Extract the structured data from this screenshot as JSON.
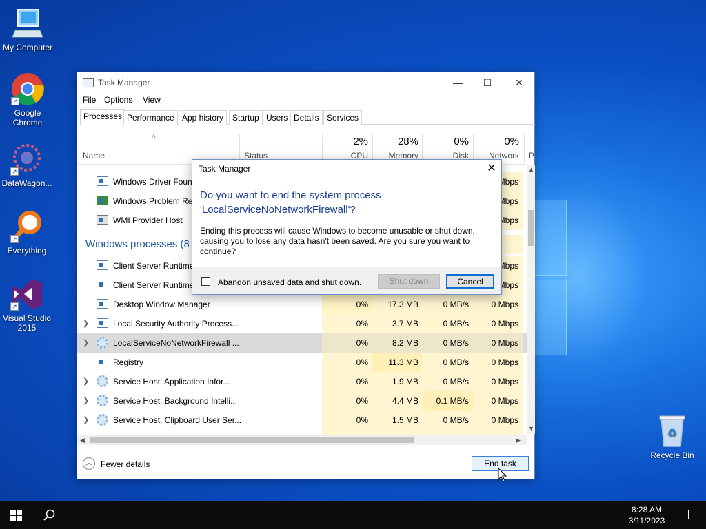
{
  "desktop": {
    "icons": [
      {
        "label": "My Computer"
      },
      {
        "label": "Google Chrome"
      },
      {
        "label": "DataWagon..."
      },
      {
        "label": "Everything"
      },
      {
        "label": "Visual Studio 2015"
      },
      {
        "label": "Recycle Bin"
      }
    ]
  },
  "window": {
    "title": "Task Manager",
    "menu": [
      "File",
      "Options",
      "View"
    ],
    "tabs": [
      "Processes",
      "Performance",
      "App history",
      "Startup",
      "Users",
      "Details",
      "Services"
    ],
    "active_tab": "Processes",
    "columns": {
      "name": "Name",
      "status": "Status",
      "cpu": {
        "pct": "2%",
        "label": "CPU"
      },
      "memory": {
        "pct": "28%",
        "label": "Memory"
      },
      "disk": {
        "pct": "0%",
        "label": "Disk"
      },
      "network": {
        "pct": "0%",
        "label": "Network"
      },
      "next": "P"
    },
    "group_label": "Windows processes (8",
    "rows_top": [
      {
        "name": "Windows Driver Found",
        "network": "Mbps"
      },
      {
        "name": "Windows Problem Rep",
        "network": "Mbps"
      },
      {
        "name": "WMI Provider Host",
        "network": "Mbps"
      }
    ],
    "rows_group": [
      {
        "name": "Client Server Runtime",
        "network": "Mbps",
        "expandable": false
      },
      {
        "name": "Client Server Runtime",
        "network": "Mbps",
        "expandable": false
      },
      {
        "name": "Desktop Window Manager",
        "cpu": "0%",
        "memory": "17.3 MB",
        "disk": "0 MB/s",
        "network": "0 Mbps",
        "expandable": false
      },
      {
        "name": "Local Security Authority Process...",
        "cpu": "0%",
        "memory": "3.7 MB",
        "disk": "0 MB/s",
        "network": "0 Mbps",
        "expandable": true
      },
      {
        "name": "LocalServiceNoNetworkFirewall ...",
        "cpu": "0%",
        "memory": "8.2 MB",
        "disk": "0 MB/s",
        "network": "0 Mbps",
        "expandable": true,
        "selected": true
      },
      {
        "name": "Registry",
        "cpu": "0%",
        "memory": "11.3 MB",
        "disk": "0 MB/s",
        "network": "0 Mbps",
        "expandable": false
      },
      {
        "name": "Service Host: Application Infor...",
        "cpu": "0%",
        "memory": "1.9 MB",
        "disk": "0 MB/s",
        "network": "0 Mbps",
        "expandable": true
      },
      {
        "name": "Service Host: Background Intelli...",
        "cpu": "0%",
        "memory": "4.4 MB",
        "disk": "0.1 MB/s",
        "network": "0 Mbps",
        "expandable": true
      },
      {
        "name": "Service Host: Clipboard User Ser...",
        "cpu": "0%",
        "memory": "1.5 MB",
        "disk": "0 MB/s",
        "network": "0 Mbps",
        "expandable": true
      }
    ],
    "footer": {
      "fewer_details": "Fewer details",
      "end_task": "End task"
    }
  },
  "dialog": {
    "title": "Task Manager",
    "question_line1": "Do you want to end the system process",
    "question_line2": "'LocalServiceNoNetworkFirewall'?",
    "body": "Ending this process will cause Windows to become unusable or shut down, causing you to lose any data hasn't been saved. Are you sure you want to continue?",
    "checkbox_label": "Abandon unsaved data and shut down.",
    "checkbox_checked": false,
    "shutdown_label": "Shut down",
    "cancel_label": "Cancel"
  },
  "taskbar": {
    "time": "8:28 AM",
    "date": "3/11/2023"
  }
}
